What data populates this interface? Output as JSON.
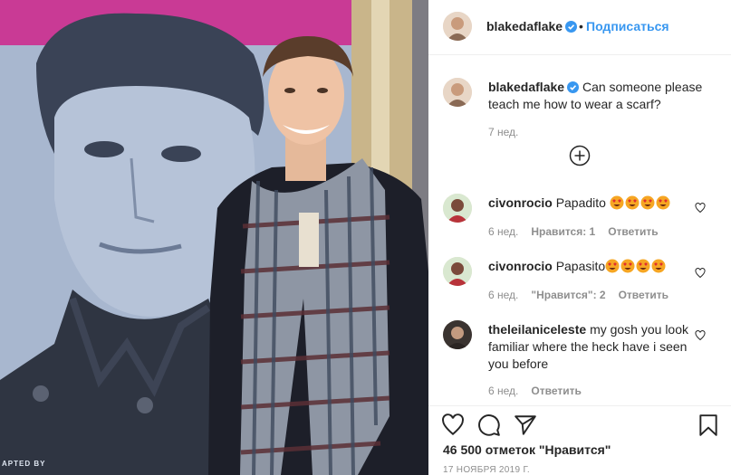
{
  "post": {
    "username": "blakedaflake",
    "follow_label": "Подписаться",
    "dot": "•",
    "caption": "Can someone please teach me how to wear a scarf?",
    "caption_time": "7 нед.",
    "likes": "46 500 отметок \"Нравится\"",
    "date": "17 НОЯБРЯ 2019 Г.",
    "poster_caption": "APTED BY"
  },
  "comments": [
    {
      "username": "civonrocio",
      "text": "Papadito",
      "emoji_count": 4,
      "time": "6 нед.",
      "likes": "Нравится: 1",
      "reply": "Ответить"
    },
    {
      "username": "civonrocio",
      "text": "Papasito",
      "emoji_count": 4,
      "time": "6 нед.",
      "likes": "\"Нравится\": 2",
      "reply": "Ответить"
    },
    {
      "username": "theleilaniceleste",
      "text": "my gosh you look familiar where the heck have i seen you before",
      "emoji_count": 0,
      "time": "6 нед.",
      "likes": "",
      "reply": "Ответить"
    }
  ],
  "icons": {
    "verified": "verified-badge-icon",
    "load_more": "plus-circle-icon",
    "like": "heart-icon",
    "comment": "comment-bubble-icon",
    "share": "paper-plane-icon",
    "save": "bookmark-icon",
    "emoji": "heart-eyes-emoji"
  },
  "colors": {
    "link": "#3897f0",
    "text": "#262626",
    "muted": "#8e8e8e",
    "divider": "#efefef",
    "emoji_face": "#f6a623",
    "emoji_heart": "#e02e2e"
  }
}
